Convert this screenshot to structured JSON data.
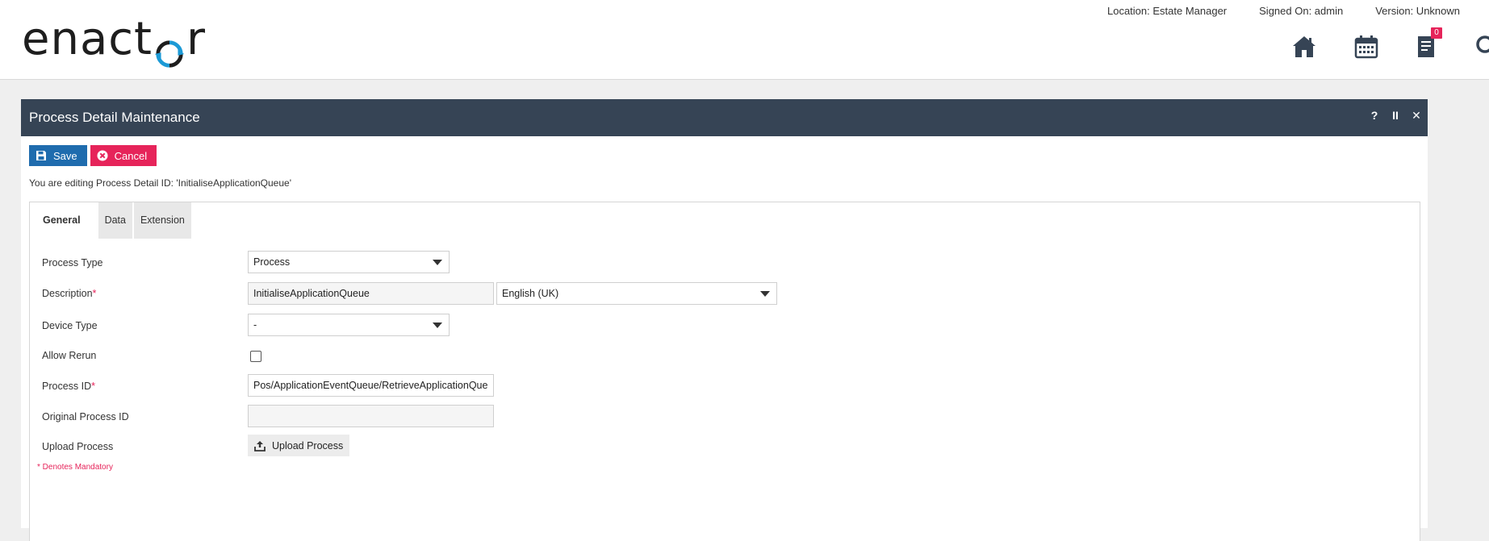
{
  "header": {
    "logo_left": "enact",
    "logo_right": "r",
    "location": "Location: Estate Manager",
    "signed_on": "Signed On: admin",
    "version": "Version: Unknown",
    "icons": [
      "home-icon",
      "calendar-icon",
      "document-icon",
      "search-icon",
      "logout-icon"
    ],
    "document_badge": "0"
  },
  "panel": {
    "title": "Process Detail Maintenance",
    "actions": {
      "help": "?",
      "pause": "II",
      "close": "✕"
    },
    "save_label": "Save",
    "cancel_label": "Cancel",
    "edit_message": "You are editing Process Detail ID: 'InitialiseApplicationQueue'"
  },
  "tabs": [
    {
      "label": "General",
      "active": true
    },
    {
      "label": "Data",
      "active": false
    },
    {
      "label": "Extension",
      "active": false
    }
  ],
  "form": {
    "process_type": {
      "label": "Process Type",
      "value": "Process"
    },
    "description": {
      "label": "Description",
      "mandatory": "*",
      "value": "InitialiseApplicationQueue",
      "language": "English (UK)"
    },
    "device_type": {
      "label": "Device Type",
      "value": "-"
    },
    "allow_rerun": {
      "label": "Allow Rerun",
      "checked": false
    },
    "process_id": {
      "label": "Process ID",
      "mandatory": "*",
      "value": "Pos/ApplicationEventQueue/RetrieveApplicationQueue"
    },
    "original_process_id": {
      "label": "Original Process ID",
      "value": ""
    },
    "upload_process": {
      "label": "Upload Process",
      "button_label": "Upload Process"
    },
    "mandatory_note": "* Denotes Mandatory"
  },
  "colors": {
    "title_bar": "#364455",
    "save": "#1f6cae",
    "cancel": "#e6245a",
    "logo_accent": "#1c9ad6"
  }
}
